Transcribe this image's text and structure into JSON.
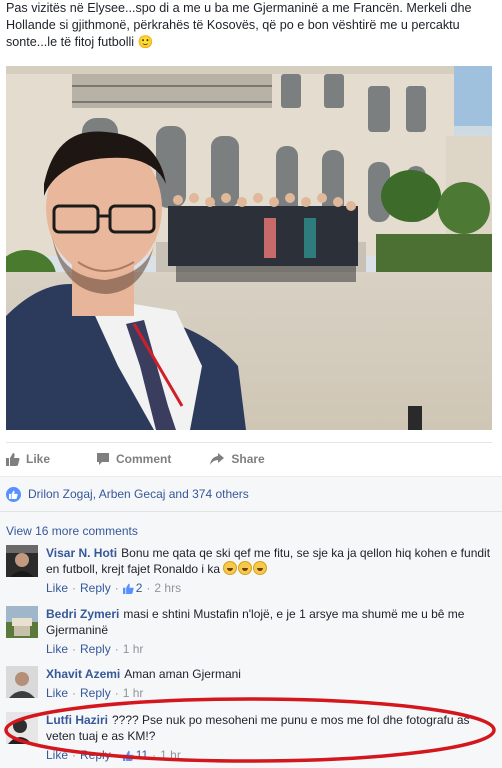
{
  "post": {
    "text": "Pas vizitës në Elysee...spo di a me u ba me Gjermaninë a me Francën. Merkeli dhe Hollande si gjithmonë, përkrahës të Kosovës, që po e bon vështirë me u percaktu sonte...le të fitoj futbolli 🙂"
  },
  "actions": {
    "like": "Like",
    "comment": "Comment",
    "share": "Share"
  },
  "likes": {
    "text": "Drilon Zogaj, Arben Gecaj and 374 others"
  },
  "comments": {
    "view_more": "View 16 more comments",
    "items": [
      {
        "author": "Visar N. Hoti",
        "text": "Bonu me qata qe ski qef me fitu, se sje ka ja qellon hiq kohen e fundit en futboll, krejt fajet Ronaldo i ka",
        "like": "Like",
        "reply": "Reply",
        "likes": "2",
        "time": "2 hrs"
      },
      {
        "author": "Bedri Zymeri",
        "text": "masi e shtini Mustafin n'lojë, e je 1 arsye ma shumë me u bê me Gjermaninë",
        "like": "Like",
        "reply": "Reply",
        "time": "1 hr"
      },
      {
        "author": "Xhavit Azemi",
        "text": "Aman aman Gjermani",
        "like": "Like",
        "reply": "Reply",
        "time": "1 hr"
      },
      {
        "author": "Lutfi Haziri",
        "text": "???? Pse nuk po mesoheni me punu e mos me fol dhe fotografu as veten tuaj e as KM!?",
        "like": "Like",
        "reply": "Reply",
        "likes": "11",
        "time": "1 hr"
      }
    ]
  },
  "colors": {
    "link": "#365899",
    "like_blue": "#5890ff",
    "annotation_red": "#d4161d"
  }
}
